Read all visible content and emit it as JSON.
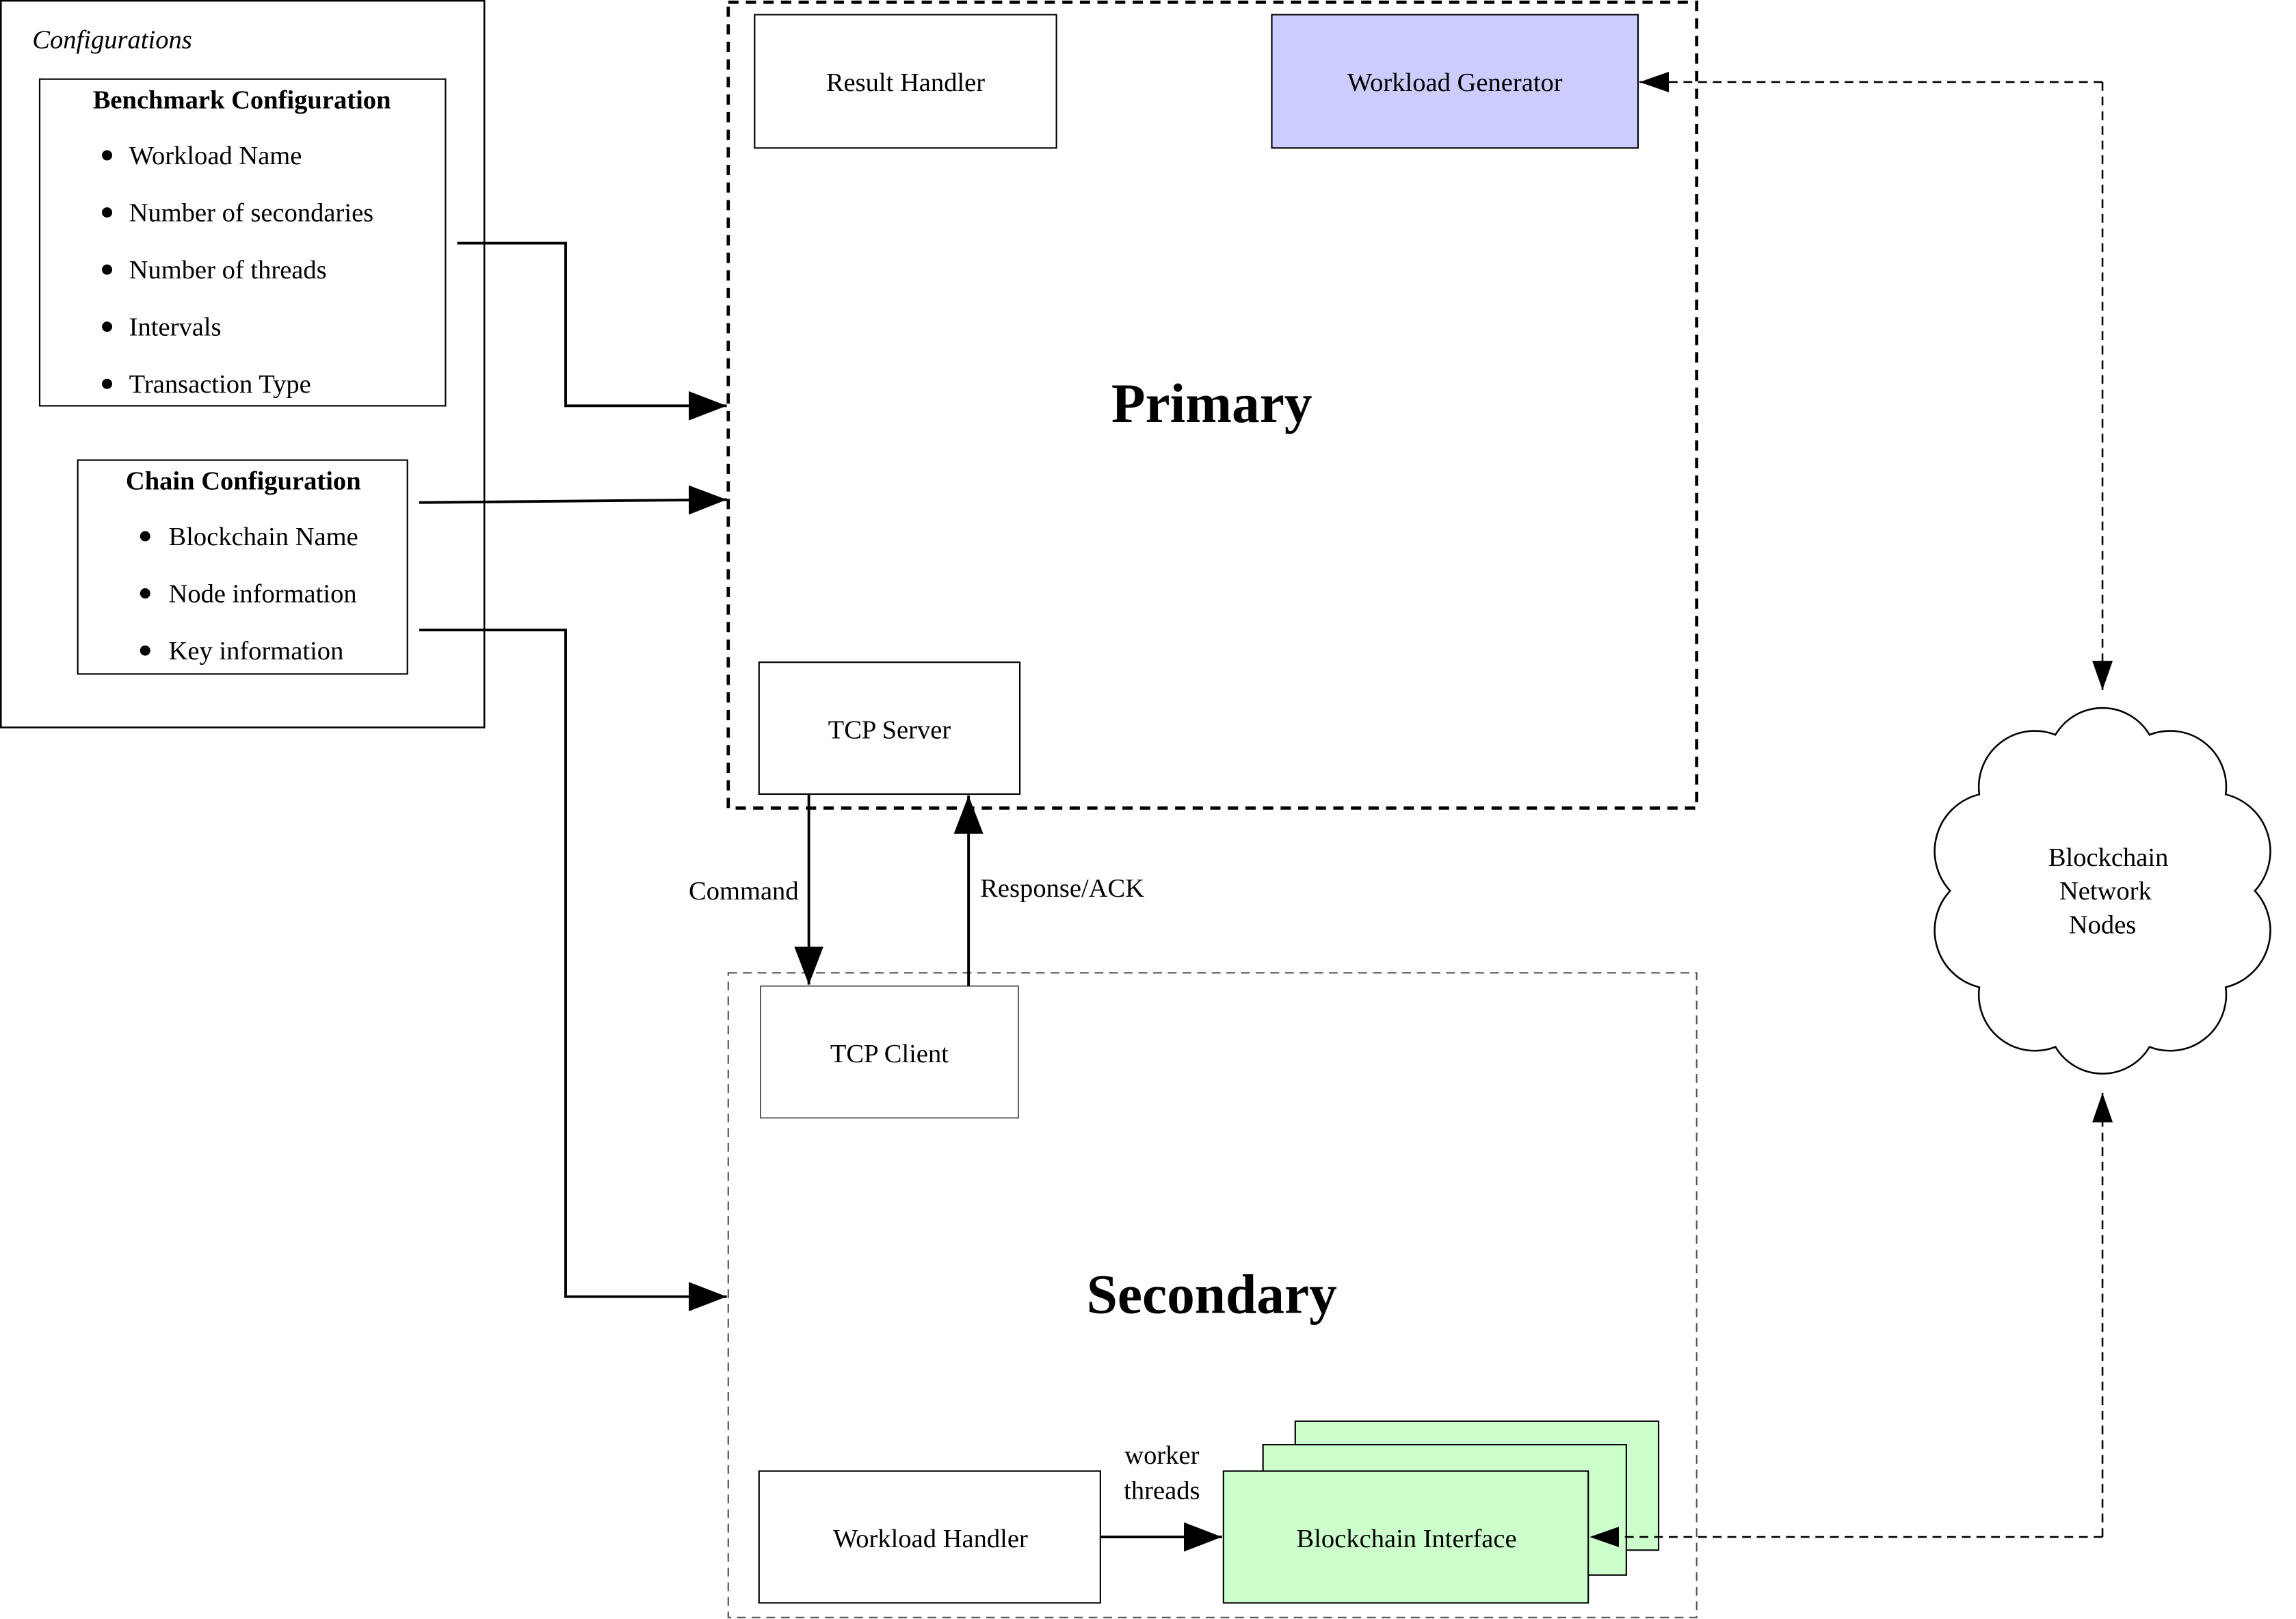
{
  "configurations": {
    "title": "Configurations",
    "benchmark": {
      "title": "Benchmark Configuration",
      "items": [
        "Workload Name",
        "Number of secondaries",
        "Number of threads",
        "Intervals",
        "Transaction Type"
      ]
    },
    "chain": {
      "title": "Chain Configuration",
      "items": [
        "Blockchain Name",
        "Node information",
        "Key information"
      ]
    }
  },
  "primary": {
    "title": "Primary",
    "result_handler": "Result Handler",
    "workload_generator": "Workload Generator",
    "tcp_server": "TCP Server"
  },
  "secondary": {
    "title": "Secondary",
    "tcp_client": "TCP Client",
    "workload_handler": "Workload Handler",
    "blockchain_interface": "Blockchain Interface",
    "worker_threads": [
      "worker",
      "threads"
    ]
  },
  "links": {
    "command": "Command",
    "response": "Response/ACK"
  },
  "cloud": {
    "lines": [
      "Blockchain",
      "Network",
      "Nodes"
    ]
  },
  "colors": {
    "workload_generator_fill": "#ccccff",
    "blockchain_interface_fill": "#ccffcc"
  }
}
